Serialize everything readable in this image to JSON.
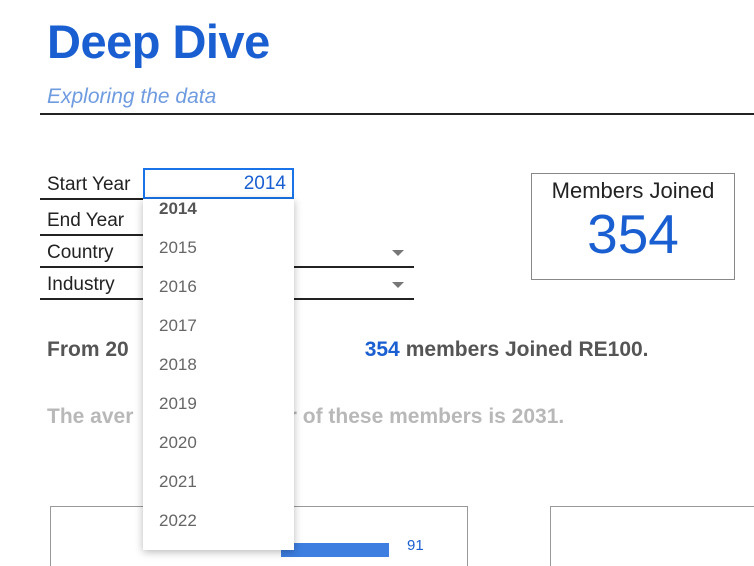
{
  "header": {
    "title": "Deep Dive",
    "subtitle": "Exploring the data"
  },
  "filters": {
    "start_year_label": "Start Year",
    "start_year_value": "2014",
    "end_year_label": "End Year",
    "country_label": "Country",
    "industry_label": "Industry"
  },
  "year_dropdown": {
    "selected": "2014",
    "options": [
      "2014",
      "2015",
      "2016",
      "2017",
      "2018",
      "2019",
      "2020",
      "2021",
      "2022"
    ]
  },
  "kpi": {
    "label": "Members Joined",
    "value": "354"
  },
  "summary": {
    "line1_prefix": "From 20",
    "line1_count": "354",
    "line1_suffix": "members Joined RE100.",
    "line2_prefix": "The aver",
    "line2_suffix": "ear of these members is 2031."
  },
  "chart_preview": {
    "bar_value_label": "91",
    "bar_color": "#3d7ee0"
  },
  "colors": {
    "accent": "#1a5fd1",
    "subtitle": "#6f9be0",
    "focus_border": "#1a73e8"
  }
}
